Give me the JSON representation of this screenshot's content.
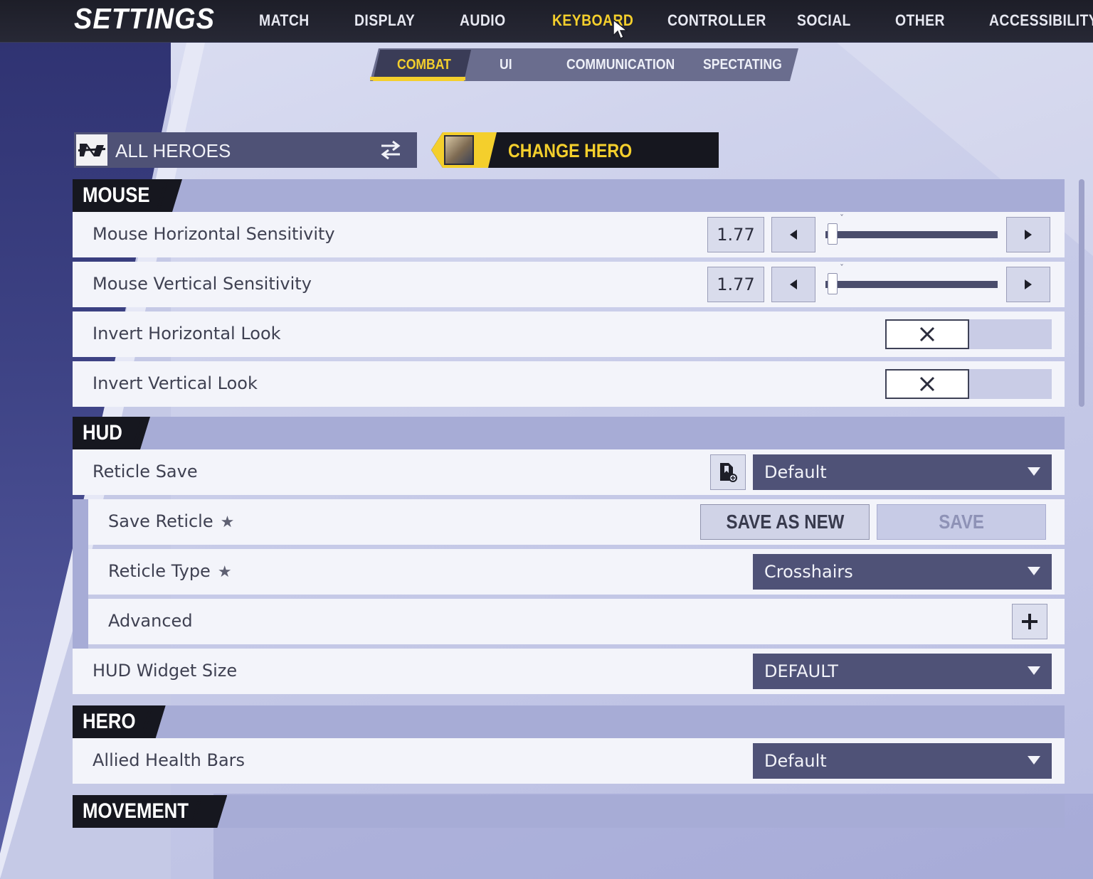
{
  "app": {
    "title": "SETTINGS"
  },
  "top_tabs": [
    {
      "label": "MATCH",
      "active": false
    },
    {
      "label": "DISPLAY",
      "active": false
    },
    {
      "label": "AUDIO",
      "active": false
    },
    {
      "label": "KEYBOARD",
      "active": true
    },
    {
      "label": "CONTROLLER",
      "active": false
    },
    {
      "label": "SOCIAL",
      "active": false
    },
    {
      "label": "OTHER",
      "active": false
    },
    {
      "label": "ACCESSIBILITY",
      "active": false
    }
  ],
  "sub_tabs": [
    {
      "label": "COMBAT",
      "active": true
    },
    {
      "label": "UI",
      "active": false
    },
    {
      "label": "COMMUNICATION",
      "active": false
    },
    {
      "label": "SPECTATING",
      "active": false
    }
  ],
  "hero_select": {
    "label": "ALL HEROES",
    "icon": "swap-icon"
  },
  "change_hero": {
    "label": "CHANGE HERO",
    "icon": "hero-portrait"
  },
  "sections": {
    "mouse": {
      "title": "MOUSE",
      "horizontal_sensitivity": {
        "label": "Mouse Horizontal Sensitivity",
        "value": "1.77",
        "level": 0.02
      },
      "vertical_sensitivity": {
        "label": "Mouse Vertical Sensitivity",
        "value": "1.77",
        "level": 0.02
      },
      "invert_horizontal": {
        "label": "Invert Horizontal Look",
        "enabled": false
      },
      "invert_vertical": {
        "label": "Invert Vertical Look",
        "enabled": false
      }
    },
    "hud": {
      "title": "HUD",
      "reticle_save": {
        "label": "Reticle Save",
        "value": "Default"
      },
      "save_reticle": {
        "label": "Save Reticle",
        "save_as_new": "SAVE AS NEW",
        "save": "SAVE"
      },
      "reticle_type": {
        "label": "Reticle Type",
        "value": "Crosshairs"
      },
      "advanced": {
        "label": "Advanced"
      },
      "widget_size": {
        "label": "HUD Widget Size",
        "value": "DEFAULT"
      }
    },
    "hero": {
      "title": "HERO",
      "allied_health_bars": {
        "label": "Allied Health Bars",
        "value": "Default"
      }
    },
    "movement": {
      "title": "MOVEMENT"
    }
  },
  "colors": {
    "accent": "#f4cf2c",
    "topbar": "#1d1e28",
    "section_header": "#a7acd6",
    "row_bg": "#f3f4fa",
    "dropdown_bg": "#4f5277"
  }
}
